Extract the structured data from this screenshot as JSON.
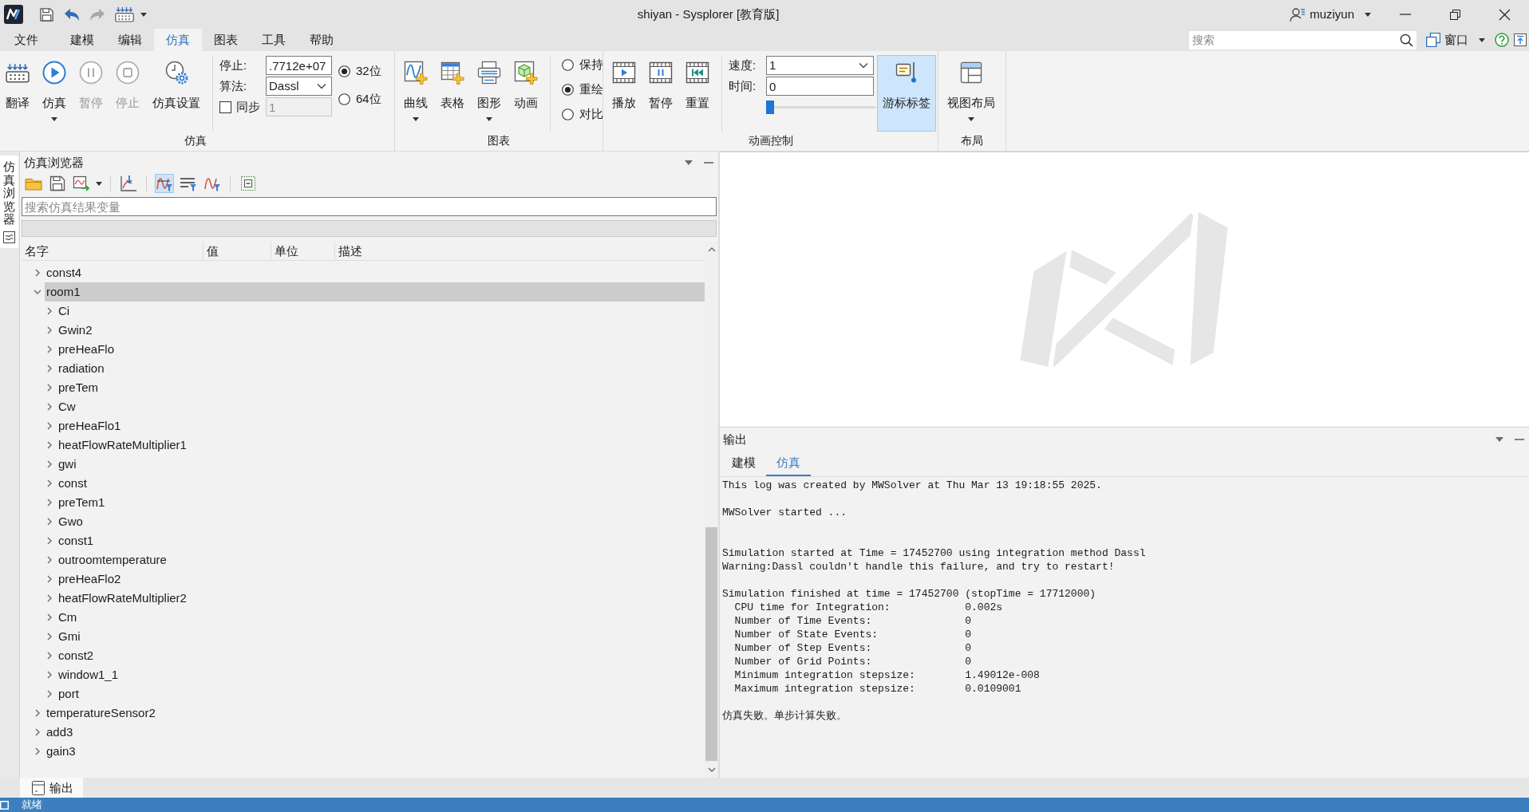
{
  "window": {
    "title": "shiyan - Sysplorer [教育版]",
    "user": "muziyun"
  },
  "quick_access": [
    {
      "disabled": false
    },
    {
      "disabled": false
    },
    {
      "disabled": true
    },
    {
      "disabled": false
    }
  ],
  "menu_tabs": [
    {
      "label": "文件",
      "selected": false
    },
    {
      "label": "建模",
      "selected": false
    },
    {
      "label": "编辑",
      "selected": false
    },
    {
      "label": "仿真",
      "selected": true
    },
    {
      "label": "图表",
      "selected": false
    },
    {
      "label": "工具",
      "selected": false
    },
    {
      "label": "帮助",
      "selected": false
    }
  ],
  "top_search": {
    "placeholder": "搜索"
  },
  "window_menu": {
    "label": "窗口"
  },
  "ribbon": [
    {
      "title": "仿真",
      "items": [
        {
          "kind": "button",
          "label": "翻译",
          "dropdown": false,
          "disabled": false,
          "active": false
        },
        {
          "kind": "button",
          "label": "仿真",
          "dropdown": true,
          "disabled": false,
          "active": false
        },
        {
          "kind": "button",
          "label": "暂停",
          "dropdown": false,
          "disabled": true,
          "active": false
        },
        {
          "kind": "button",
          "label": "停止",
          "dropdown": false,
          "disabled": true,
          "active": false
        },
        {
          "kind": "button",
          "label": "仿真设置",
          "dropdown": false,
          "disabled": false,
          "active": false
        },
        {
          "kind": "separator"
        },
        {
          "kind": "form",
          "rows": [
            {
              "kind": "input",
              "label": "停止:",
              "value": ".7712e+07",
              "disabled": false
            },
            {
              "kind": "select",
              "label": "算法:",
              "value": "Dassl"
            },
            {
              "kind": "checkbox",
              "label": "同步",
              "checked": false,
              "value": "1",
              "disabled": true
            }
          ]
        },
        {
          "kind": "radios",
          "options": [
            {
              "label": "32位",
              "selected": true
            },
            {
              "label": "64位",
              "selected": false
            }
          ]
        }
      ]
    },
    {
      "title": "图表",
      "items": [
        {
          "kind": "button",
          "label": "曲线",
          "dropdown": true,
          "disabled": false,
          "active": false
        },
        {
          "kind": "button",
          "label": "表格",
          "dropdown": false,
          "disabled": false,
          "active": false
        },
        {
          "kind": "button",
          "label": "图形",
          "dropdown": true,
          "disabled": false,
          "active": false
        },
        {
          "kind": "button",
          "label": "动画",
          "dropdown": false,
          "disabled": false,
          "active": false
        },
        {
          "kind": "separator"
        },
        {
          "kind": "radios",
          "options": [
            {
              "label": "保持",
              "selected": false
            },
            {
              "label": "重绘",
              "selected": true
            },
            {
              "label": "对比",
              "selected": false
            }
          ]
        }
      ]
    },
    {
      "title": "动画控制",
      "items": [
        {
          "kind": "button",
          "label": "播放",
          "dropdown": false,
          "disabled": false,
          "active": false
        },
        {
          "kind": "button",
          "label": "暂停",
          "dropdown": false,
          "disabled": false,
          "active": false
        },
        {
          "kind": "button",
          "label": "重置",
          "dropdown": false,
          "disabled": false,
          "active": false
        },
        {
          "kind": "separator"
        },
        {
          "kind": "form",
          "rows": [
            {
              "kind": "select",
              "label": "速度:",
              "value": "1"
            },
            {
              "kind": "input",
              "label": "时间:",
              "value": "0",
              "disabled": false
            },
            {
              "kind": "slider",
              "level": 0
            }
          ]
        },
        {
          "kind": "button",
          "label": "游标标签",
          "dropdown": false,
          "disabled": false,
          "active": true
        }
      ]
    },
    {
      "title": "布局",
      "items": [
        {
          "kind": "button",
          "label": "视图布局",
          "dropdown": true,
          "disabled": false,
          "active": false
        }
      ]
    }
  ],
  "browser": {
    "side_tab": "仿真浏览器",
    "title": "仿真浏览器",
    "toolbar": [
      {
        "kind": "button",
        "selected": false
      },
      {
        "kind": "button",
        "selected": false
      },
      {
        "kind": "menu-button",
        "selected": false
      },
      {
        "kind": "separator"
      },
      {
        "kind": "button",
        "selected": false
      },
      {
        "kind": "separator"
      },
      {
        "kind": "button",
        "selected": true
      },
      {
        "kind": "button",
        "selected": false
      },
      {
        "kind": "button",
        "selected": false
      },
      {
        "kind": "separator"
      },
      {
        "kind": "button",
        "selected": false
      }
    ],
    "search": {
      "placeholder": "搜索仿真结果变量"
    },
    "columns": [
      "名字",
      "值",
      "单位",
      "描述"
    ],
    "tree": [
      {
        "label": "const4",
        "expanded": false,
        "selected": false
      },
      {
        "label": "room1",
        "expanded": true,
        "selected": true,
        "children": [
          {
            "label": "Ci",
            "expanded": false,
            "selected": false
          },
          {
            "label": "Gwin2",
            "expanded": false,
            "selected": false
          },
          {
            "label": "preHeaFlo",
            "expanded": false,
            "selected": false
          },
          {
            "label": "radiation",
            "expanded": false,
            "selected": false
          },
          {
            "label": "preTem",
            "expanded": false,
            "selected": false
          },
          {
            "label": "Cw",
            "expanded": false,
            "selected": false
          },
          {
            "label": "preHeaFlo1",
            "expanded": false,
            "selected": false
          },
          {
            "label": "heatFlowRateMultiplier1",
            "expanded": false,
            "selected": false
          },
          {
            "label": "gwi",
            "expanded": false,
            "selected": false
          },
          {
            "label": "const",
            "expanded": false,
            "selected": false
          },
          {
            "label": "preTem1",
            "expanded": false,
            "selected": false
          },
          {
            "label": "Gwo",
            "expanded": false,
            "selected": false
          },
          {
            "label": "const1",
            "expanded": false,
            "selected": false
          },
          {
            "label": "outroomtemperature",
            "expanded": false,
            "selected": false
          },
          {
            "label": "preHeaFlo2",
            "expanded": false,
            "selected": false
          },
          {
            "label": "heatFlowRateMultiplier2",
            "expanded": false,
            "selected": false
          },
          {
            "label": "Cm",
            "expanded": false,
            "selected": false
          },
          {
            "label": "Gmi",
            "expanded": false,
            "selected": false
          },
          {
            "label": "const2",
            "expanded": false,
            "selected": false
          },
          {
            "label": "window1_1",
            "expanded": false,
            "selected": false
          },
          {
            "label": "port",
            "expanded": false,
            "selected": false
          }
        ]
      },
      {
        "label": "temperatureSensor2",
        "expanded": false,
        "selected": false
      },
      {
        "label": "add3",
        "expanded": false,
        "selected": false
      },
      {
        "label": "gain3",
        "expanded": false,
        "selected": false
      }
    ]
  },
  "output": {
    "title": "输出",
    "tabs": [
      {
        "label": "建模",
        "selected": false
      },
      {
        "label": "仿真",
        "selected": true
      }
    ],
    "log": "This log was created by MWSolver at Thu Mar 13 19:18:55 2025.\n\nMWSolver started ...\n\n\nSimulation started at Time = 17452700 using integration method Dassl\nWarning:Dassl couldn't handle this failure, and try to restart!\n\nSimulation finished at time = 17452700 (stopTime = 17712000)\n  CPU time for Integration:            0.002s\n  Number of Time Events:               0\n  Number of State Events:              0\n  Number of Step Events:               0\n  Number of Grid Points:               0\n  Minimum integration stepsize:        1.49012e-008\n  Maximum integration stepsize:        0.0109001\n\n仿真失败。单步计算失败。"
  },
  "dock_tabs": [
    {
      "label": "输出",
      "selected": true
    }
  ],
  "status": "就绪"
}
